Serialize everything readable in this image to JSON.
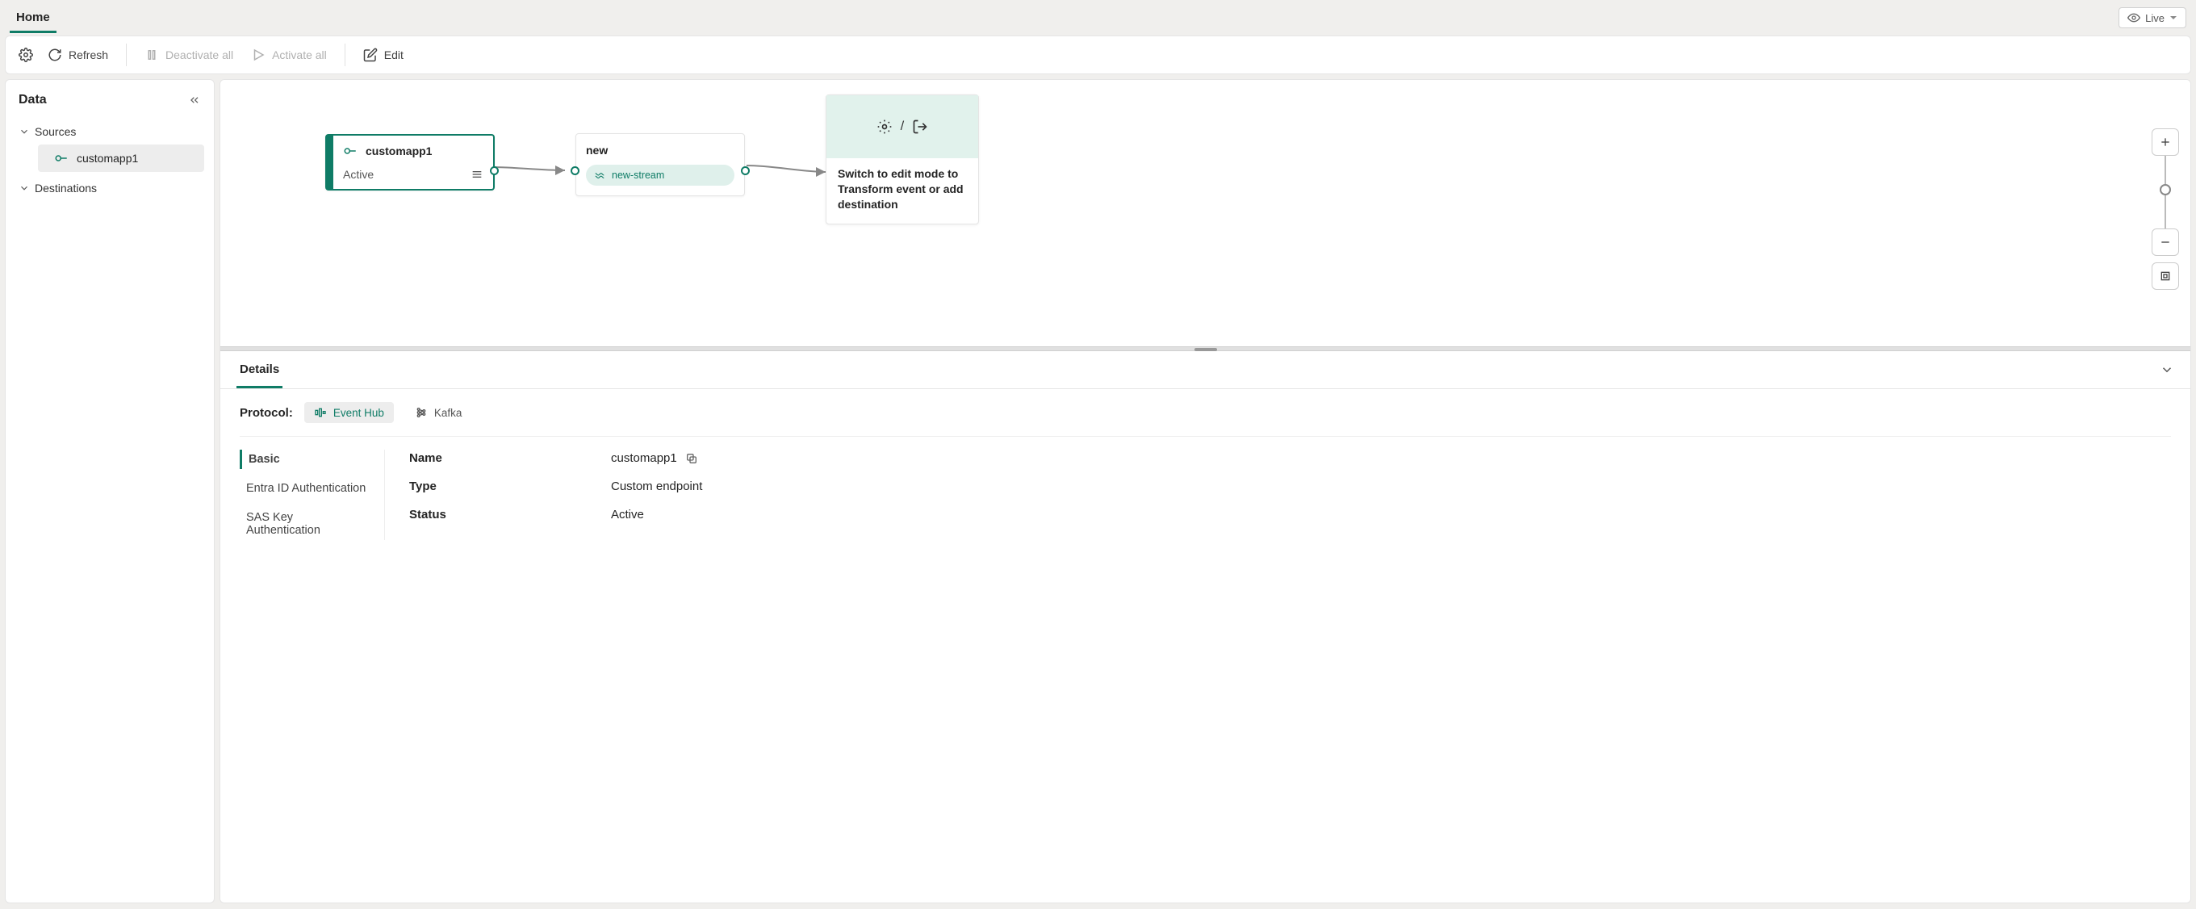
{
  "topTabs": {
    "home": "Home"
  },
  "liveDropdown": {
    "label": "Live"
  },
  "toolbar": {
    "refresh": "Refresh",
    "deactivateAll": "Deactivate all",
    "activateAll": "Activate all",
    "edit": "Edit"
  },
  "sidebar": {
    "title": "Data",
    "sources": {
      "label": "Sources",
      "items": [
        "customapp1"
      ]
    },
    "destinations": {
      "label": "Destinations"
    }
  },
  "canvas": {
    "sourceNode": {
      "title": "customapp1",
      "status": "Active"
    },
    "streamNode": {
      "title": "new",
      "stream": "new-stream"
    },
    "destNode": {
      "hint": "Switch to edit mode to Transform event or add destination"
    }
  },
  "details": {
    "tab": "Details",
    "protocolLabel": "Protocol:",
    "protocols": {
      "eventHub": "Event Hub",
      "kafka": "Kafka"
    },
    "leftNav": {
      "basic": "Basic",
      "entra": "Entra ID Authentication",
      "sas": "SAS Key Authentication"
    },
    "basic": {
      "nameKey": "Name",
      "nameVal": "customapp1",
      "typeKey": "Type",
      "typeVal": "Custom endpoint",
      "statusKey": "Status",
      "statusVal": "Active"
    }
  }
}
